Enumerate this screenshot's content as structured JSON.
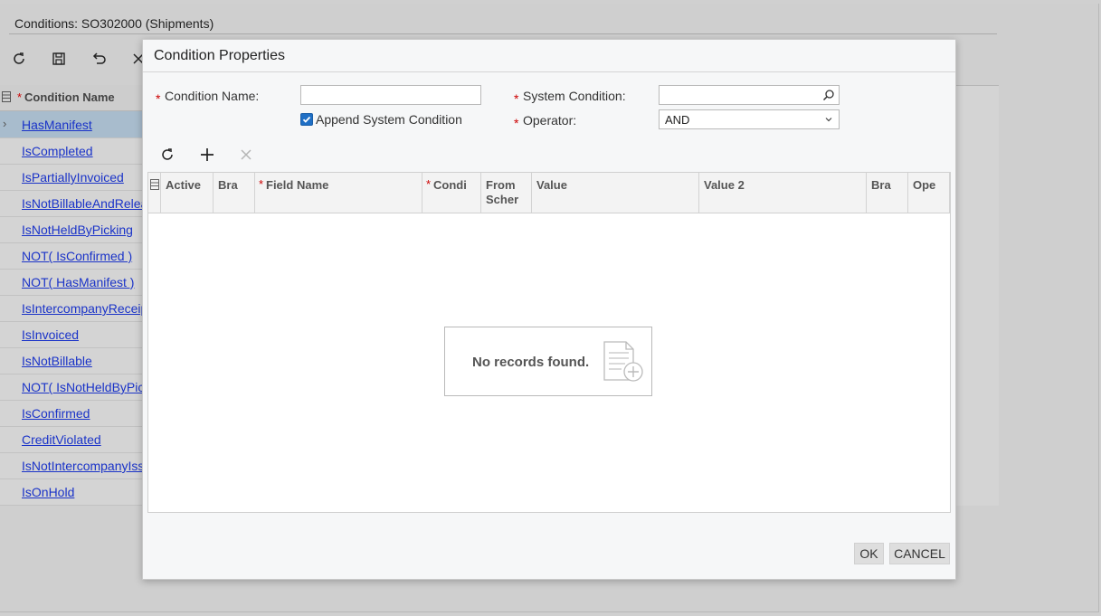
{
  "background": {
    "title": "Conditions: SO302000 (Shipments)",
    "toolbar": [
      "refresh-icon",
      "save-icon",
      "undo-icon",
      "close-icon"
    ],
    "grid": {
      "header": "Condition Name",
      "rows": [
        "HasManifest",
        "IsCompleted",
        "IsPartiallyInvoiced",
        "IsNotBillableAndReleas",
        "IsNotHeldByPicking",
        "NOT( IsConfirmed )",
        "NOT( HasManifest )",
        "IsIntercompanyReceipt",
        "IsInvoiced",
        "IsNotBillable",
        "NOT( IsNotHeldByPick",
        "IsConfirmed",
        "CreditViolated",
        "IsNotIntercompanyIssu",
        "IsOnHold"
      ],
      "selected_row": 0
    }
  },
  "dialog": {
    "title": "Condition Properties",
    "form": {
      "condition_name_label": "Condition Name:",
      "condition_name_value": "",
      "append_label": "Append System Condition",
      "append_checked": true,
      "system_condition_label": "System Condition:",
      "system_condition_value": "",
      "operator_label": "Operator:",
      "operator_value": "AND"
    },
    "toolbar": [
      "refresh-icon",
      "add-icon",
      "delete-icon"
    ],
    "grid": {
      "columns": [
        {
          "label": "Active",
          "required": false
        },
        {
          "label": "Bra",
          "required": false
        },
        {
          "label": "Field Name",
          "required": true
        },
        {
          "label": "Condi",
          "required": true
        },
        {
          "label": "From Scher",
          "required": false
        },
        {
          "label": "Value",
          "required": false
        },
        {
          "label": "Value 2",
          "required": false
        },
        {
          "label": "Bra",
          "required": false
        },
        {
          "label": "Ope",
          "required": false
        }
      ],
      "empty_message": "No records found."
    },
    "buttons": {
      "ok": "OK",
      "cancel": "CANCEL"
    }
  }
}
